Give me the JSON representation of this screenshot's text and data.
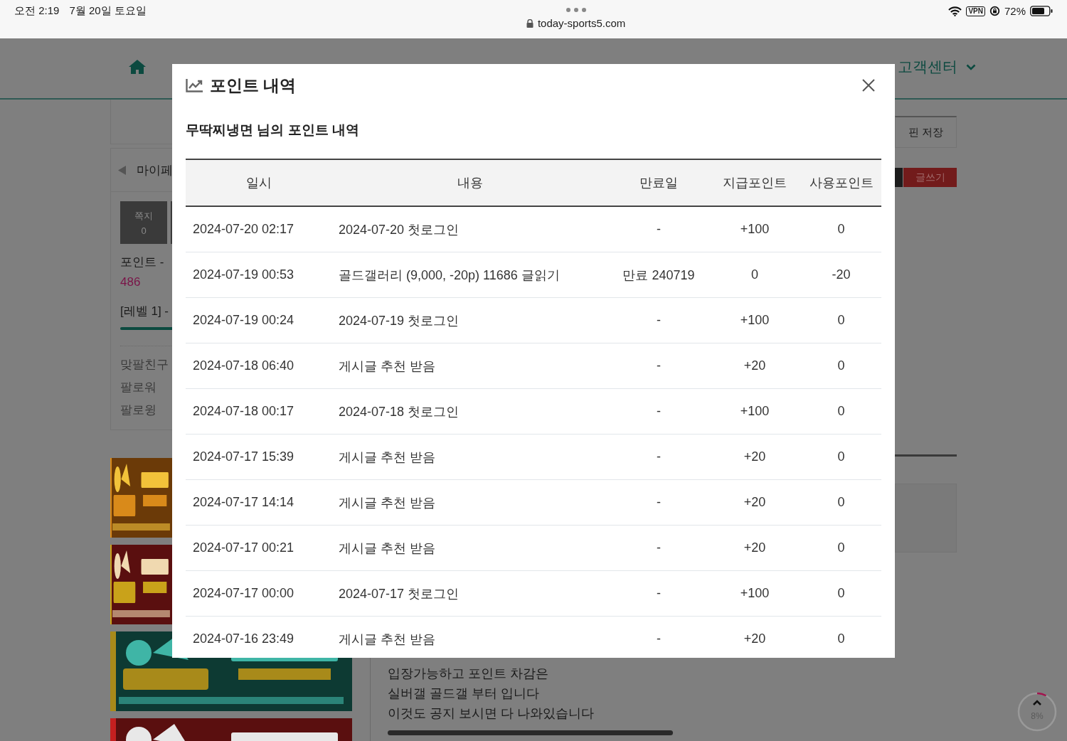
{
  "status_bar": {
    "time": "오전 2:19",
    "date": "7월 20일 토요일",
    "url": "today-sports5.com",
    "vpn": "VPN",
    "battery": "72%"
  },
  "nav": {
    "last_item": "고객센터"
  },
  "sidebar": {
    "title": "마이페",
    "message_tile": {
      "label": "쪽지",
      "count": "0"
    },
    "points_label": "포인트 -",
    "points_value": "486",
    "level_label": "[레벨 1] -",
    "links": [
      "맞팔친구",
      "팔로워",
      "팔로윙"
    ]
  },
  "notice": {
    "lines": [
      "입장가능하고 포인트 차감은",
      "실버갤 골드갤 부터 입니다",
      "이것도 공지 보시면 다 나와있습니다"
    ]
  },
  "right_panel": {
    "pin_button": "핀 저장",
    "write_button": "글쓰기"
  },
  "scroll_top": {
    "percent": "8%",
    "level": 0.08
  },
  "modal": {
    "title": "포인트 내역",
    "subtitle": "무딱찌냉면 님의 포인트 내역",
    "columns": [
      "일시",
      "내용",
      "만료일",
      "지급포인트",
      "사용포인트"
    ],
    "rows": [
      [
        "2024-07-20 02:17",
        "2024-07-20 첫로그인",
        "-",
        "+100",
        "0"
      ],
      [
        "2024-07-19 00:53",
        "골드갤러리 (9,000, -20p) 11686 글읽기",
        "만료 240719",
        "0",
        "-20"
      ],
      [
        "2024-07-19 00:24",
        "2024-07-19 첫로그인",
        "-",
        "+100",
        "0"
      ],
      [
        "2024-07-18 06:40",
        "게시글 추천 받음",
        "-",
        "+20",
        "0"
      ],
      [
        "2024-07-18 00:17",
        "2024-07-18 첫로그인",
        "-",
        "+100",
        "0"
      ],
      [
        "2024-07-17 15:39",
        "게시글 추천 받음",
        "-",
        "+20",
        "0"
      ],
      [
        "2024-07-17 14:14",
        "게시글 추천 받음",
        "-",
        "+20",
        "0"
      ],
      [
        "2024-07-17 00:21",
        "게시글 추천 받음",
        "-",
        "+20",
        "0"
      ],
      [
        "2024-07-17 00:00",
        "2024-07-17 첫로그인",
        "-",
        "+100",
        "0"
      ],
      [
        "2024-07-16 23:49",
        "게시글 추천 받음",
        "-",
        "+20",
        "0"
      ]
    ]
  }
}
